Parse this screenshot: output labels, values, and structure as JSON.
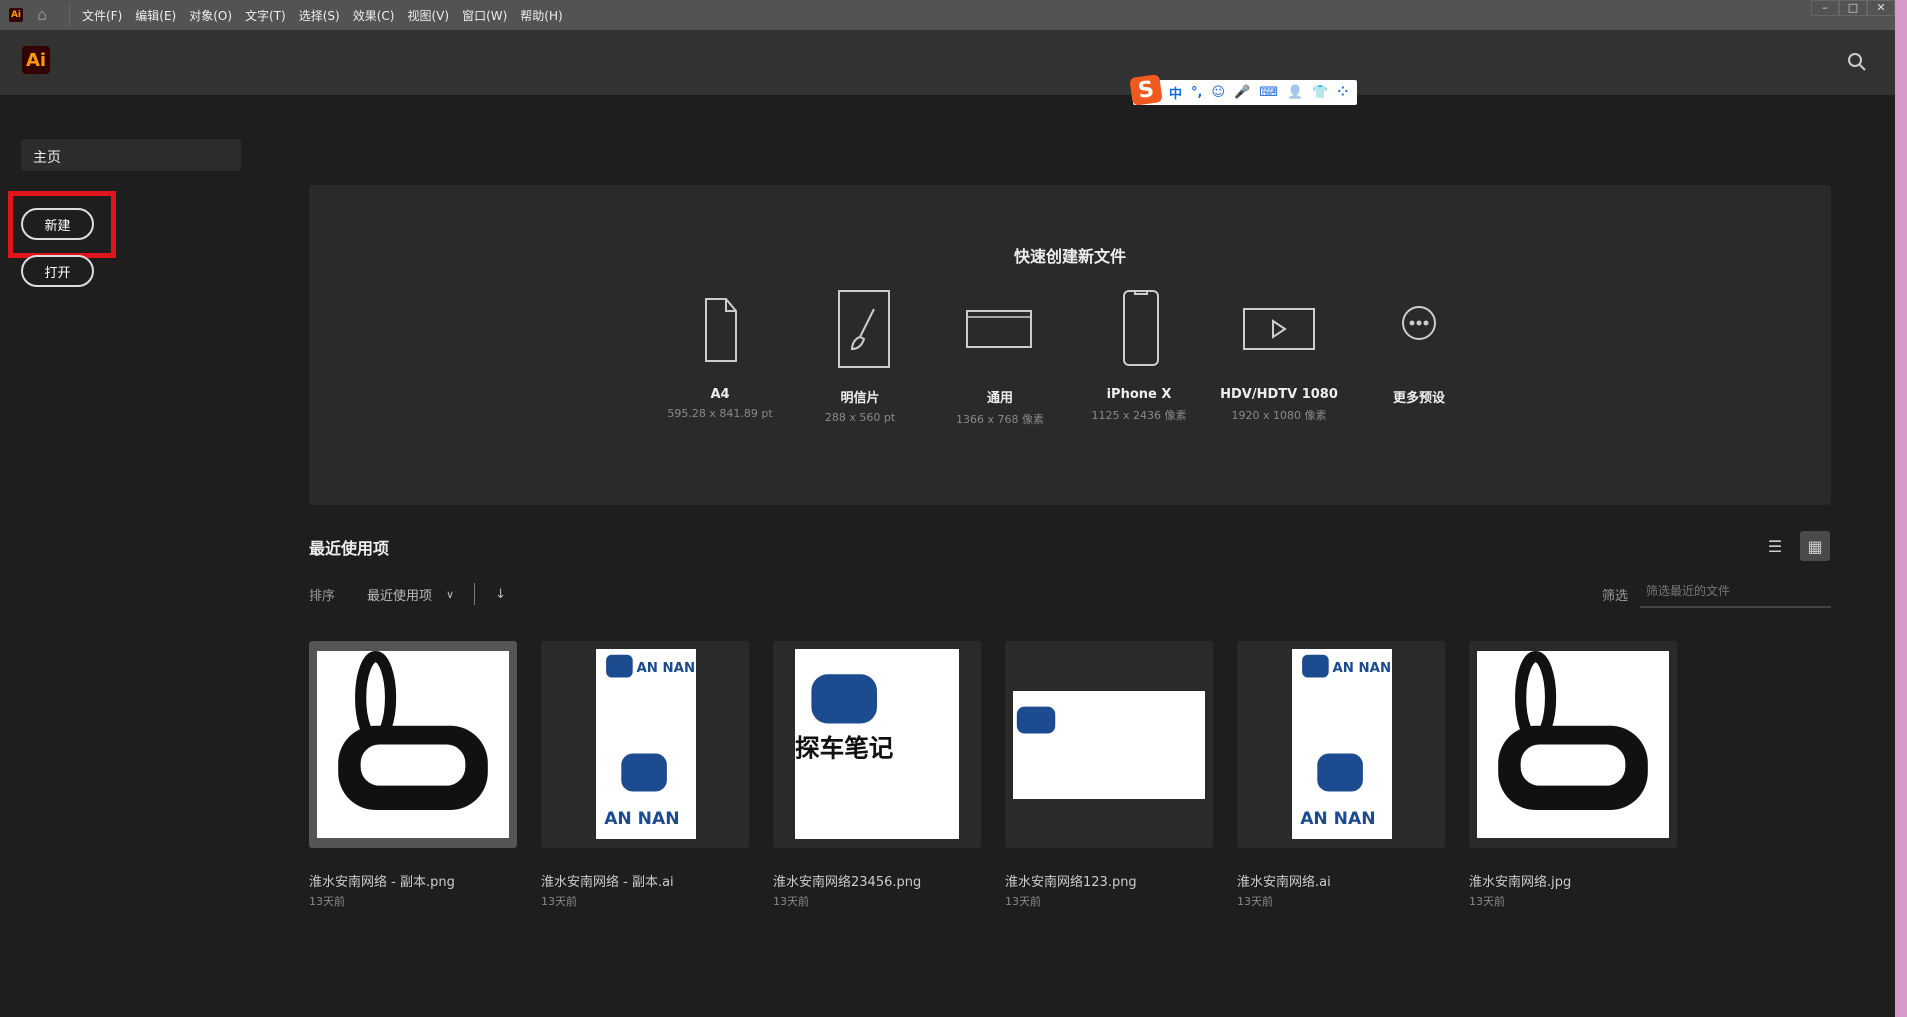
{
  "menubar": {
    "app_icon": "Ai",
    "items": [
      "文件(F)",
      "编辑(E)",
      "对象(O)",
      "文字(T)",
      "选择(S)",
      "效果(C)",
      "视图(V)",
      "窗口(W)",
      "帮助(H)"
    ]
  },
  "header": {
    "logo": "Ai",
    "search_icon": "search-icon"
  },
  "ime": {
    "items": [
      "中",
      "°,",
      "☺",
      "🎤",
      "⌨",
      "👤",
      "👕",
      "⁘"
    ]
  },
  "sidebar": {
    "home": "主页",
    "new": "新建",
    "open": "打开"
  },
  "quick": {
    "title": "快速创建新文件",
    "presets": [
      {
        "name": "A4",
        "size": "595.28 x 841.89 pt",
        "icon": "document-icon"
      },
      {
        "name": "明信片",
        "size": "288 x 560 pt",
        "icon": "brush-icon"
      },
      {
        "name": "通用",
        "size": "1366 x 768 像素",
        "icon": "browser-window-icon"
      },
      {
        "name": "iPhone X",
        "size": "1125 x 2436 像素",
        "icon": "phone-icon"
      },
      {
        "name": "HDV/HDTV 1080",
        "size": "1920 x 1080 像素",
        "icon": "video-icon"
      },
      {
        "name": "更多预设",
        "size": "",
        "icon": "more-icon"
      }
    ]
  },
  "recent": {
    "title": "最近使用项",
    "sort_label": "排序",
    "sort_value": "最近使用项",
    "filter_label": "筛选",
    "filter_placeholder": "筛选最近的文件",
    "files": [
      {
        "name": "淮水安南网络 - 副本.png",
        "date": "13天前"
      },
      {
        "name": "淮水安南网络 - 副本.ai",
        "date": "13天前"
      },
      {
        "name": "淮水安南网络23456.png",
        "date": "13天前"
      },
      {
        "name": "淮水安南网络123.png",
        "date": "13天前"
      },
      {
        "name": "淮水安南网络.ai",
        "date": "13天前"
      },
      {
        "name": "淮水安南网络.jpg",
        "date": "13天前"
      }
    ]
  }
}
